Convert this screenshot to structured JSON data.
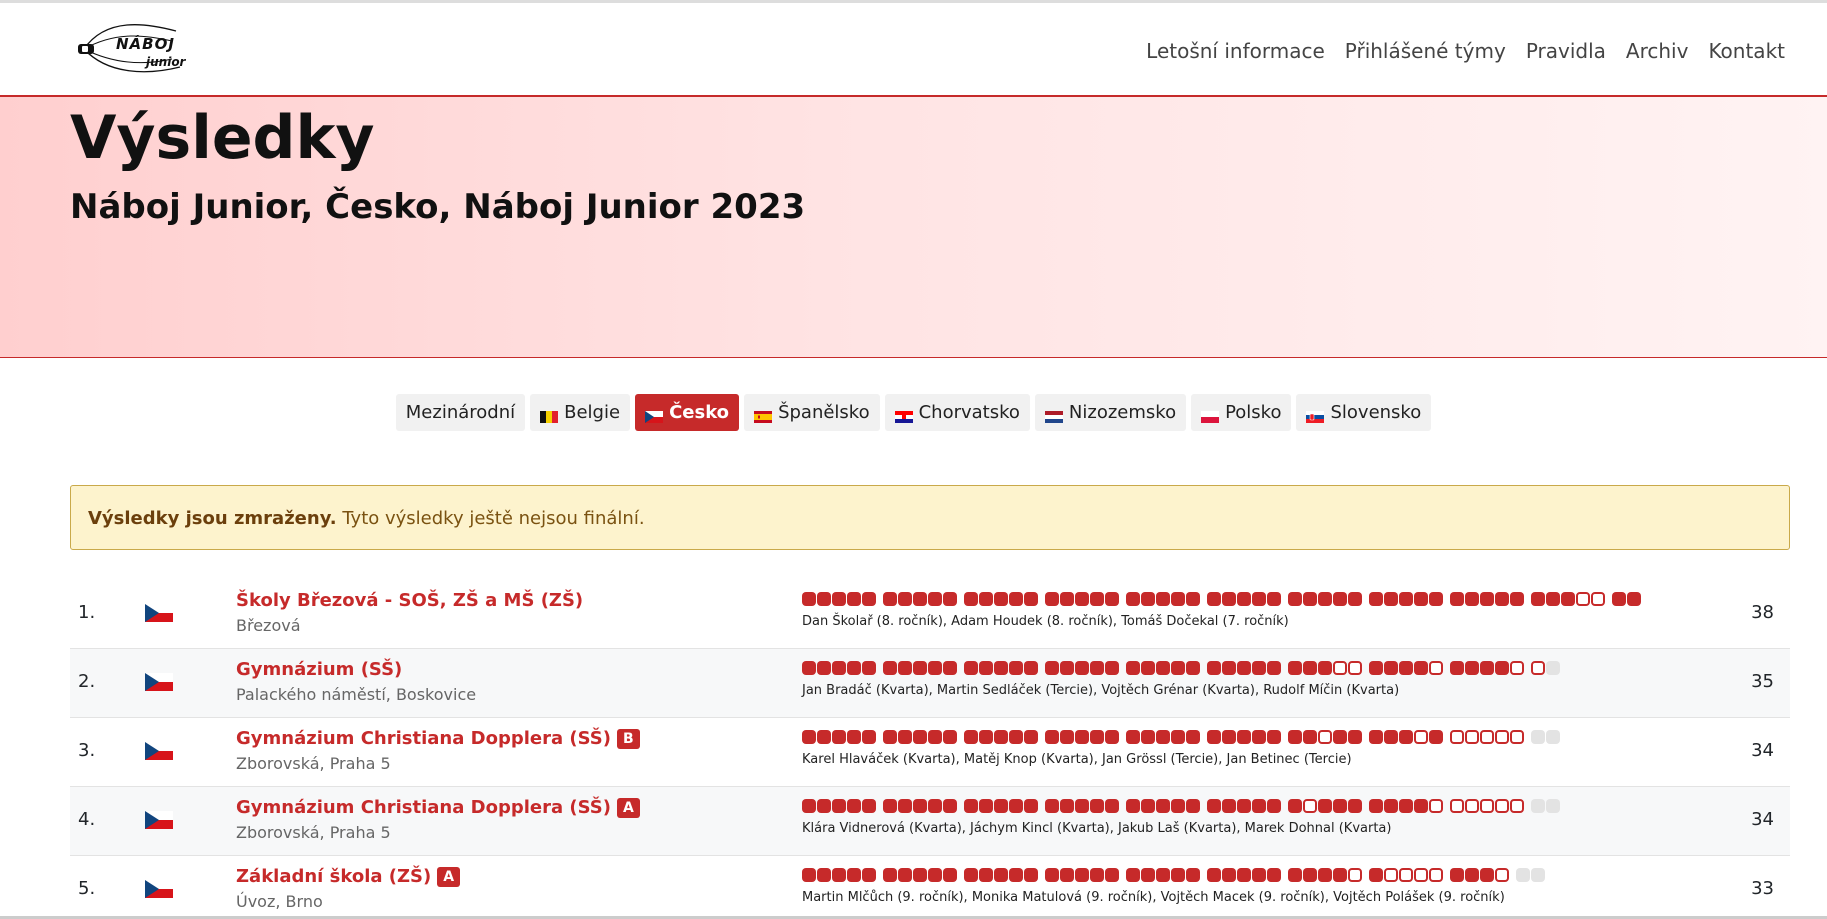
{
  "brand": {
    "line1": "NÁBOJ",
    "line2": "junior"
  },
  "nav": [
    {
      "label": "Letošní informace"
    },
    {
      "label": "Přihlášené týmy"
    },
    {
      "label": "Pravidla"
    },
    {
      "label": "Archiv"
    },
    {
      "label": "Kontakt"
    }
  ],
  "hero": {
    "title": "Výsledky",
    "subtitle": "Náboj Junior, Česko, Náboj Junior 2023"
  },
  "tabs": [
    {
      "label": "Mezinárodní",
      "flag": ""
    },
    {
      "label": "Belgie",
      "flag": "be"
    },
    {
      "label": "Česko",
      "flag": "cz",
      "active": true
    },
    {
      "label": "Španělsko",
      "flag": "es"
    },
    {
      "label": "Chorvatsko",
      "flag": "hr"
    },
    {
      "label": "Nizozemsko",
      "flag": "nl"
    },
    {
      "label": "Polsko",
      "flag": "pl"
    },
    {
      "label": "Slovensko",
      "flag": "sk"
    }
  ],
  "alert": {
    "strong": "Výsledky jsou zmraženy.",
    "text": " Tyto výsledky ještě nejsou finální."
  },
  "colors": {
    "accent": "#c62a2a",
    "alert_bg": "#fdf3cd"
  },
  "results": [
    {
      "rank": "1.",
      "country": "cz",
      "name": "Školy Březová - SOŠ, ZŠ a MŠ (ZŠ)",
      "category": "",
      "address": "Březová",
      "problems": "sssss sssss sssss sssss sssss sssss sssss sssss sssss sssoo ss",
      "members": "Dan Školař (8. ročník), Adam Houdek (8. ročník), Tomáš Dočekal (7. ročník)",
      "score": "38"
    },
    {
      "rank": "2.",
      "country": "cz",
      "name": "Gymnázium (SŠ)",
      "category": "",
      "address": "Palackého náměstí, Boskovice",
      "problems": "sssss sssss sssss sssss sssss sssss sssoo sssso sssso ou",
      "members": "Jan Bradáč (Kvarta), Martin Sedláček (Tercie), Vojtěch Grénar (Kvarta), Rudolf Míčin (Kvarta)",
      "score": "35"
    },
    {
      "rank": "3.",
      "country": "cz",
      "name": "Gymnázium Christiana Dopplera (SŠ)",
      "category": "B",
      "address": "Zborovská, Praha 5",
      "problems": "sssss sssss sssss sssss sssss sssss ssoss sssos ooooo uu",
      "members": "Karel Hlaváček (Kvarta), Matěj Knop (Kvarta), Jan Grössl (Tercie), Jan Betinec (Tercie)",
      "score": "34"
    },
    {
      "rank": "4.",
      "country": "cz",
      "name": "Gymnázium Christiana Dopplera (SŠ)",
      "category": "A",
      "address": "Zborovská, Praha 5",
      "problems": "sssss sssss sssss sssss sssss sssss sosss sssso ooooo uu",
      "members": "Klára Vidnerová (Kvarta), Jáchym Kincl (Kvarta), Jakub Laš (Kvarta), Marek Dohnal (Kvarta)",
      "score": "34"
    },
    {
      "rank": "5.",
      "country": "cz",
      "name": "Základní škola (ZŠ)",
      "category": "A",
      "address": "Úvoz, Brno",
      "problems": "sssss sssss sssss sssss sssss sssss sssso soooo ssso uu",
      "members": "Martin Mlčůch (9. ročník), Monika Matulová (9. ročník), Vojtěch Macek (9. ročník), Vojtěch Polášek (9. ročník)",
      "score": "33"
    }
  ]
}
